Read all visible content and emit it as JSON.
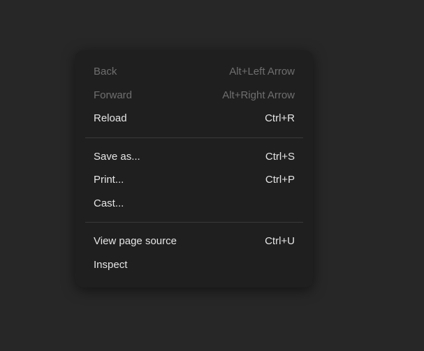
{
  "menu": {
    "groups": [
      {
        "items": [
          {
            "label": "Back",
            "shortcut": "Alt+Left Arrow",
            "enabled": false,
            "name": "menu-item-back"
          },
          {
            "label": "Forward",
            "shortcut": "Alt+Right Arrow",
            "enabled": false,
            "name": "menu-item-forward"
          },
          {
            "label": "Reload",
            "shortcut": "Ctrl+R",
            "enabled": true,
            "name": "menu-item-reload"
          }
        ]
      },
      {
        "items": [
          {
            "label": "Save as...",
            "shortcut": "Ctrl+S",
            "enabled": true,
            "name": "menu-item-save-as"
          },
          {
            "label": "Print...",
            "shortcut": "Ctrl+P",
            "enabled": true,
            "name": "menu-item-print"
          },
          {
            "label": "Cast...",
            "shortcut": "",
            "enabled": true,
            "name": "menu-item-cast"
          }
        ]
      },
      {
        "items": [
          {
            "label": "View page source",
            "shortcut": "Ctrl+U",
            "enabled": true,
            "name": "menu-item-view-page-source"
          },
          {
            "label": "Inspect",
            "shortcut": "",
            "enabled": true,
            "name": "menu-item-inspect"
          }
        ]
      }
    ]
  }
}
